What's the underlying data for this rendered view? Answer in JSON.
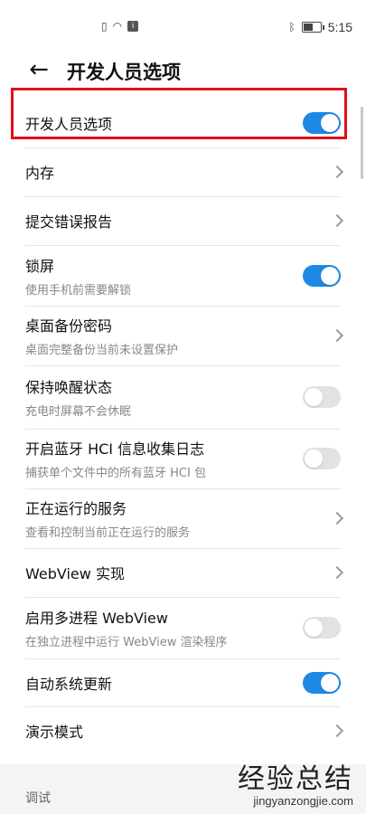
{
  "status_bar": {
    "left_icons": [
      "sim-no-service-icon",
      "wifi-icon",
      "notification-badge-icon"
    ],
    "right_icons": [
      "bluetooth-icon",
      "battery-icon"
    ],
    "time": "5:15",
    "battery_level_fraction": 0.55
  },
  "header": {
    "back_icon": "back-arrow-icon",
    "title": "开发人员选项"
  },
  "items": [
    {
      "title": "开发人员选项",
      "subtitle": "",
      "control": "toggle",
      "on": true
    },
    {
      "title": "内存",
      "subtitle": "",
      "control": "chevron"
    },
    {
      "title": "提交错误报告",
      "subtitle": "",
      "control": "chevron"
    },
    {
      "title": "锁屏",
      "subtitle": "使用手机前需要解锁",
      "control": "toggle",
      "on": true
    },
    {
      "title": "桌面备份密码",
      "subtitle": "桌面完整备份当前未设置保护",
      "control": "chevron"
    },
    {
      "title": "保持唤醒状态",
      "subtitle": "充电时屏幕不会休眠",
      "control": "toggle",
      "on": false
    },
    {
      "title": "开启蓝牙 HCI 信息收集日志",
      "subtitle": "捕获单个文件中的所有蓝牙 HCI 包",
      "control": "toggle",
      "on": false
    },
    {
      "title": "正在运行的服务",
      "subtitle": "查看和控制当前正在运行的服务",
      "control": "chevron"
    },
    {
      "title": "WebView 实现",
      "subtitle": "",
      "control": "chevron"
    },
    {
      "title": "启用多进程 WebView",
      "subtitle": "在独立进程中运行 WebView 渲染程序",
      "control": "toggle",
      "on": false
    },
    {
      "title": "自动系统更新",
      "subtitle": "",
      "control": "toggle",
      "on": true
    },
    {
      "title": "演示模式",
      "subtitle": "",
      "control": "chevron"
    }
  ],
  "section": {
    "label": "调试"
  },
  "watermark": {
    "cn": "经验总结",
    "en": "jingyanzongjie.com"
  },
  "colors": {
    "toggle_on": "#1e88e5",
    "toggle_off": "#e2e2e2",
    "highlight_box": "#e0101a"
  }
}
